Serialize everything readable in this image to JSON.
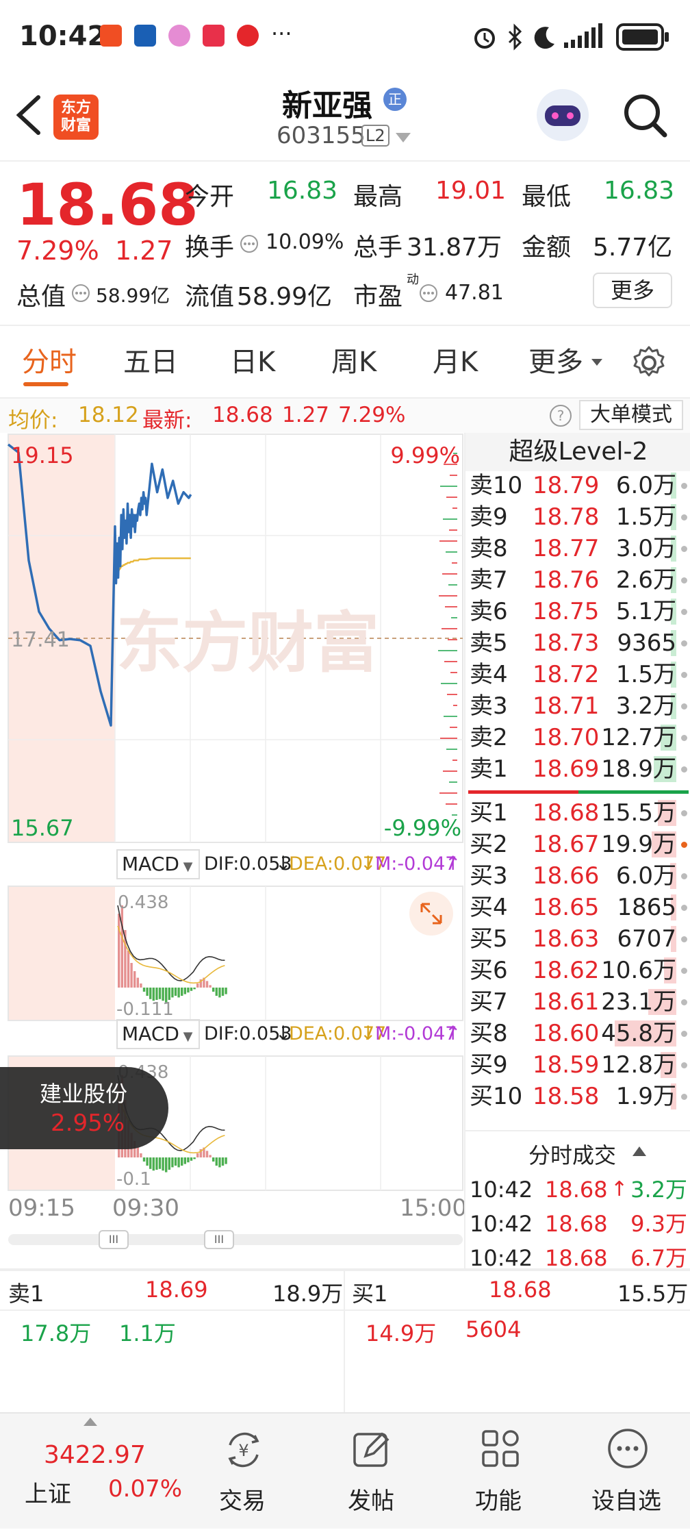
{
  "status_bar": {
    "time": "10:42",
    "more": "···"
  },
  "header": {
    "logo_line1": "东方",
    "logo_line2": "财富",
    "stock_name": "新亚强",
    "badge": "正",
    "stock_code": "603155",
    "level_tag": "L2"
  },
  "quote": {
    "price": "18.68",
    "change_pct": "7.29%",
    "change": "1.27",
    "open_label": "今开",
    "open": "16.83",
    "high_label": "最高",
    "high": "19.01",
    "low_label": "最低",
    "low": "16.83",
    "turnover_label": "换手",
    "turnover": "10.09%",
    "volume_label": "总手",
    "volume": "31.87万",
    "amount_label": "金额",
    "amount": "5.77亿",
    "mktcap_label": "总值",
    "mktcap": "58.99亿",
    "float_label": "流值",
    "float": "58.99亿",
    "pe_label": "市盈",
    "pe_sup": "动",
    "pe": "47.81",
    "more_button": "更多"
  },
  "tabs": [
    {
      "label": "分时",
      "active": true
    },
    {
      "label": "五日",
      "active": false
    },
    {
      "label": "日K",
      "active": false
    },
    {
      "label": "周K",
      "active": false
    },
    {
      "label": "月K",
      "active": false
    },
    {
      "label": "更多",
      "active": false
    }
  ],
  "avg_line": {
    "avg_label": "均价:",
    "avg_value": "18.12",
    "latest_label": "最新:",
    "latest_value": "18.68",
    "latest_change": "1.27",
    "latest_pct": "7.29%",
    "big_order_button": "大单模式"
  },
  "chart": {
    "watermark": "东方财富",
    "y_top": "19.15",
    "y_mid": "17.41",
    "y_bottom": "15.67",
    "pct_top": "9.99%",
    "pct_bottom": "-9.99%",
    "t_start": "09:15",
    "t_open": "09:30",
    "t_end": "15:00"
  },
  "chart_data": {
    "type": "line",
    "title": "",
    "x": [
      "09:15",
      "09:16",
      "09:17",
      "09:18",
      "09:19",
      "09:20",
      "09:21",
      "09:22",
      "09:23",
      "09:24",
      "09:25",
      "09:30",
      "09:31",
      "09:32",
      "09:33",
      "09:34",
      "09:35",
      "09:36",
      "09:37",
      "09:38",
      "09:39",
      "09:40",
      "09:41",
      "09:42",
      "09:43",
      "09:44",
      "09:45",
      "09:46",
      "09:47",
      "09:48",
      "09:49",
      "09:50",
      "09:51",
      "09:52",
      "09:53",
      "09:54",
      "09:55",
      "09:56",
      "09:57",
      "09:58",
      "09:59",
      "10:00",
      "10:05",
      "10:10",
      "10:15",
      "10:20",
      "10:25",
      "10:30",
      "10:35",
      "10:40",
      "10:42"
    ],
    "series": [
      {
        "values": [
          19.12,
          19.05,
          18.1,
          17.65,
          17.5,
          17.4,
          17.41,
          17.4,
          17.35,
          16.95,
          16.65,
          18.4,
          17.9,
          18.25,
          17.95,
          18.3,
          18.05,
          18.5,
          18.2,
          18.55,
          18.3,
          18.45,
          18.25,
          18.6,
          18.35,
          18.5,
          18.3,
          18.55,
          18.4,
          18.5,
          18.35,
          18.5,
          18.45,
          18.55,
          18.6,
          18.5,
          18.65,
          18.55,
          18.7,
          18.6,
          18.65,
          18.5,
          18.95,
          18.7,
          18.9,
          18.65,
          18.8,
          18.6,
          18.7,
          18.65,
          18.68
        ]
      },
      {
        "values": [
          null,
          null,
          null,
          null,
          null,
          null,
          null,
          null,
          null,
          null,
          null,
          18.05,
          18.0,
          17.98,
          18.0,
          18.02,
          18.03,
          18.05,
          18.05,
          18.06,
          18.06,
          18.07,
          18.07,
          18.08,
          18.08,
          18.08,
          18.09,
          18.09,
          18.09,
          18.1,
          18.1,
          18.1,
          18.1,
          18.1,
          18.11,
          18.11,
          18.11,
          18.11,
          18.11,
          18.11,
          18.11,
          18.11,
          18.12,
          18.12,
          18.12,
          18.12,
          18.12,
          18.12,
          18.12,
          18.12,
          18.12
        ]
      }
    ],
    "ylim": [
      15.67,
      19.15
    ],
    "prev_close": 17.41
  },
  "macd": {
    "label": "MACD",
    "dif": "DIF:0.053",
    "dea": "DEA:0.077",
    "m": "M:-0.047",
    "top_value": "0.438",
    "bottom_value": "-0.111"
  },
  "macd2": {
    "label": "MACD",
    "dif": "DIF:0.053",
    "dea": "DEA:0.077",
    "m": "M:-0.047",
    "top_value": "0.438",
    "bottom_value": "-0.1"
  },
  "popup": {
    "name": "建业股份",
    "pct": "2.95%"
  },
  "order_book": {
    "title": "超级Level-2",
    "sells": [
      {
        "label": "卖10",
        "price": "18.79",
        "vol": "6.0万",
        "bar": 0.05
      },
      {
        "label": "卖9",
        "price": "18.78",
        "vol": "1.5万",
        "bar": 0.03
      },
      {
        "label": "卖8",
        "price": "18.77",
        "vol": "3.0万",
        "bar": 0.04
      },
      {
        "label": "卖7",
        "price": "18.76",
        "vol": "2.6万",
        "bar": 0.04
      },
      {
        "label": "卖6",
        "price": "18.75",
        "vol": "5.1万",
        "bar": 0.05
      },
      {
        "label": "卖5",
        "price": "18.73",
        "vol": "9365",
        "bar": 0.02
      },
      {
        "label": "卖4",
        "price": "18.72",
        "vol": "1.5万",
        "bar": 0.03
      },
      {
        "label": "卖3",
        "price": "18.71",
        "vol": "3.2万",
        "bar": 0.04
      },
      {
        "label": "卖2",
        "price": "18.70",
        "vol": "12.7万",
        "bar": 0.25
      },
      {
        "label": "卖1",
        "price": "18.69",
        "vol": "18.9万",
        "bar": 0.37
      }
    ],
    "buys": [
      {
        "label": "买1",
        "price": "18.68",
        "vol": "15.5万",
        "bar": 0.3
      },
      {
        "label": "买2",
        "price": "18.67",
        "vol": "19.9万",
        "bar": 0.4
      },
      {
        "label": "买3",
        "price": "18.66",
        "vol": "6.0万",
        "bar": 0.1
      },
      {
        "label": "买4",
        "price": "18.65",
        "vol": "1865",
        "bar": 0.01
      },
      {
        "label": "买5",
        "price": "18.63",
        "vol": "6707",
        "bar": 0.01
      },
      {
        "label": "买6",
        "price": "18.62",
        "vol": "10.6万",
        "bar": 0.2
      },
      {
        "label": "买7",
        "price": "18.61",
        "vol": "23.1万",
        "bar": 0.45
      },
      {
        "label": "买8",
        "price": "18.60",
        "vol": "45.8万",
        "bar": 1.0
      },
      {
        "label": "买9",
        "price": "18.59",
        "vol": "12.8万",
        "bar": 0.25
      },
      {
        "label": "买10",
        "price": "18.58",
        "vol": "1.9万",
        "bar": 0.03
      }
    ],
    "trades_title": "分时成交",
    "trades": [
      {
        "time": "10:42",
        "price": "18.68",
        "vol": "3.2万",
        "arrow": "↑"
      },
      {
        "time": "10:42",
        "price": "18.68",
        "vol": "9.3万",
        "arrow": ""
      },
      {
        "time": "10:42",
        "price": "18.68",
        "vol": "6.7万",
        "arrow": ""
      }
    ]
  },
  "bottom_info": {
    "sell_label": "卖1",
    "sell_price": "18.69",
    "sell_vol": "18.9万",
    "sell_sub1": "17.8万",
    "sell_sub2": "1.1万",
    "buy_label": "买1",
    "buy_price": "18.68",
    "buy_vol": "15.5万",
    "buy_sub1": "14.9万",
    "buy_sub2": "5604"
  },
  "nav": {
    "index_value": "3422.97",
    "index_name": "上证",
    "index_pct": "0.07%",
    "items": [
      "交易",
      "发帖",
      "功能",
      "设自选"
    ]
  },
  "colors": {
    "up": "#e4262b",
    "down": "#1aa34a",
    "line": "#2f6db5",
    "avg": "#e8b83a",
    "accent": "#e8641d"
  }
}
